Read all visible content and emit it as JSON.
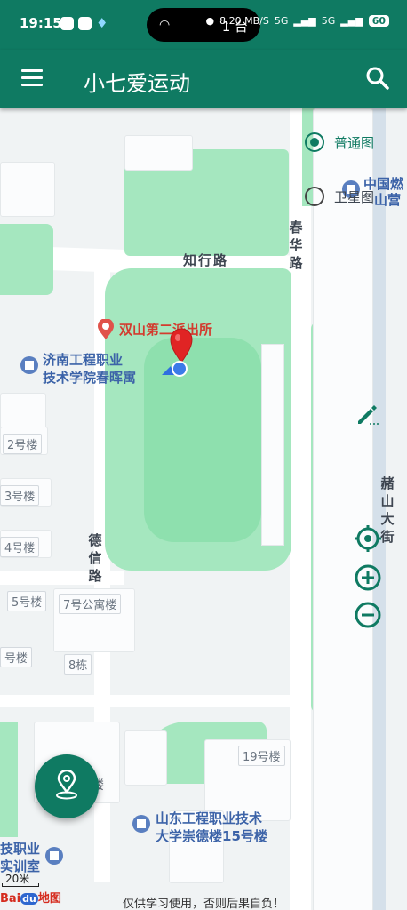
{
  "status_bar": {
    "time": "19:15",
    "island_text": "1 台",
    "network_speed": "8.20 MB/S",
    "signal_1": "5G",
    "signal_2": "5G",
    "battery": "60"
  },
  "app_bar": {
    "title": "小七爱运动",
    "menu_icon": "hamburger-menu-icon",
    "search_icon": "search-icon"
  },
  "map_type": {
    "option_1": "普通图",
    "option_2": "卫星图",
    "selected": "普通图"
  },
  "map": {
    "roads": {
      "zhixing": "知行路",
      "chunhua": "春华路",
      "dexin": "德信路",
      "zhushan": "赭山大街"
    },
    "pois": {
      "police": "双山第二派出所",
      "dorm_line1": "济南工程职业",
      "dorm_line2": "技术学院春晖寓",
      "gas_line1": "中国燃",
      "gas_line2": "山营",
      "school_line1": "山东工程职业技术",
      "school_line2": "大学崇德楼15号楼",
      "lab_line1": "技职业",
      "lab_line2": "实训室"
    },
    "buildings": {
      "b2": "2号楼",
      "b3": "3号楼",
      "b4": "4号楼",
      "b5": "5号楼",
      "b7": "7号公寓楼",
      "b8": "8栋",
      "b19": "19号楼",
      "edge": "号楼",
      "lou": "楼"
    },
    "scale": "20米",
    "logo_text": "地图",
    "disclaimer": "仅供学习使用，否则后果自负！"
  },
  "colors": {
    "primary": "#0f7a62",
    "grass": "#a5e7bf",
    "pin": "#e02424",
    "location_dot": "#3b7be8"
  },
  "icons": {
    "edit": "pencil-icon",
    "locate": "crosshair-icon",
    "zoom_in": "plus-circle-icon",
    "zoom_out": "minus-circle-icon",
    "fab": "location-pin-icon"
  }
}
